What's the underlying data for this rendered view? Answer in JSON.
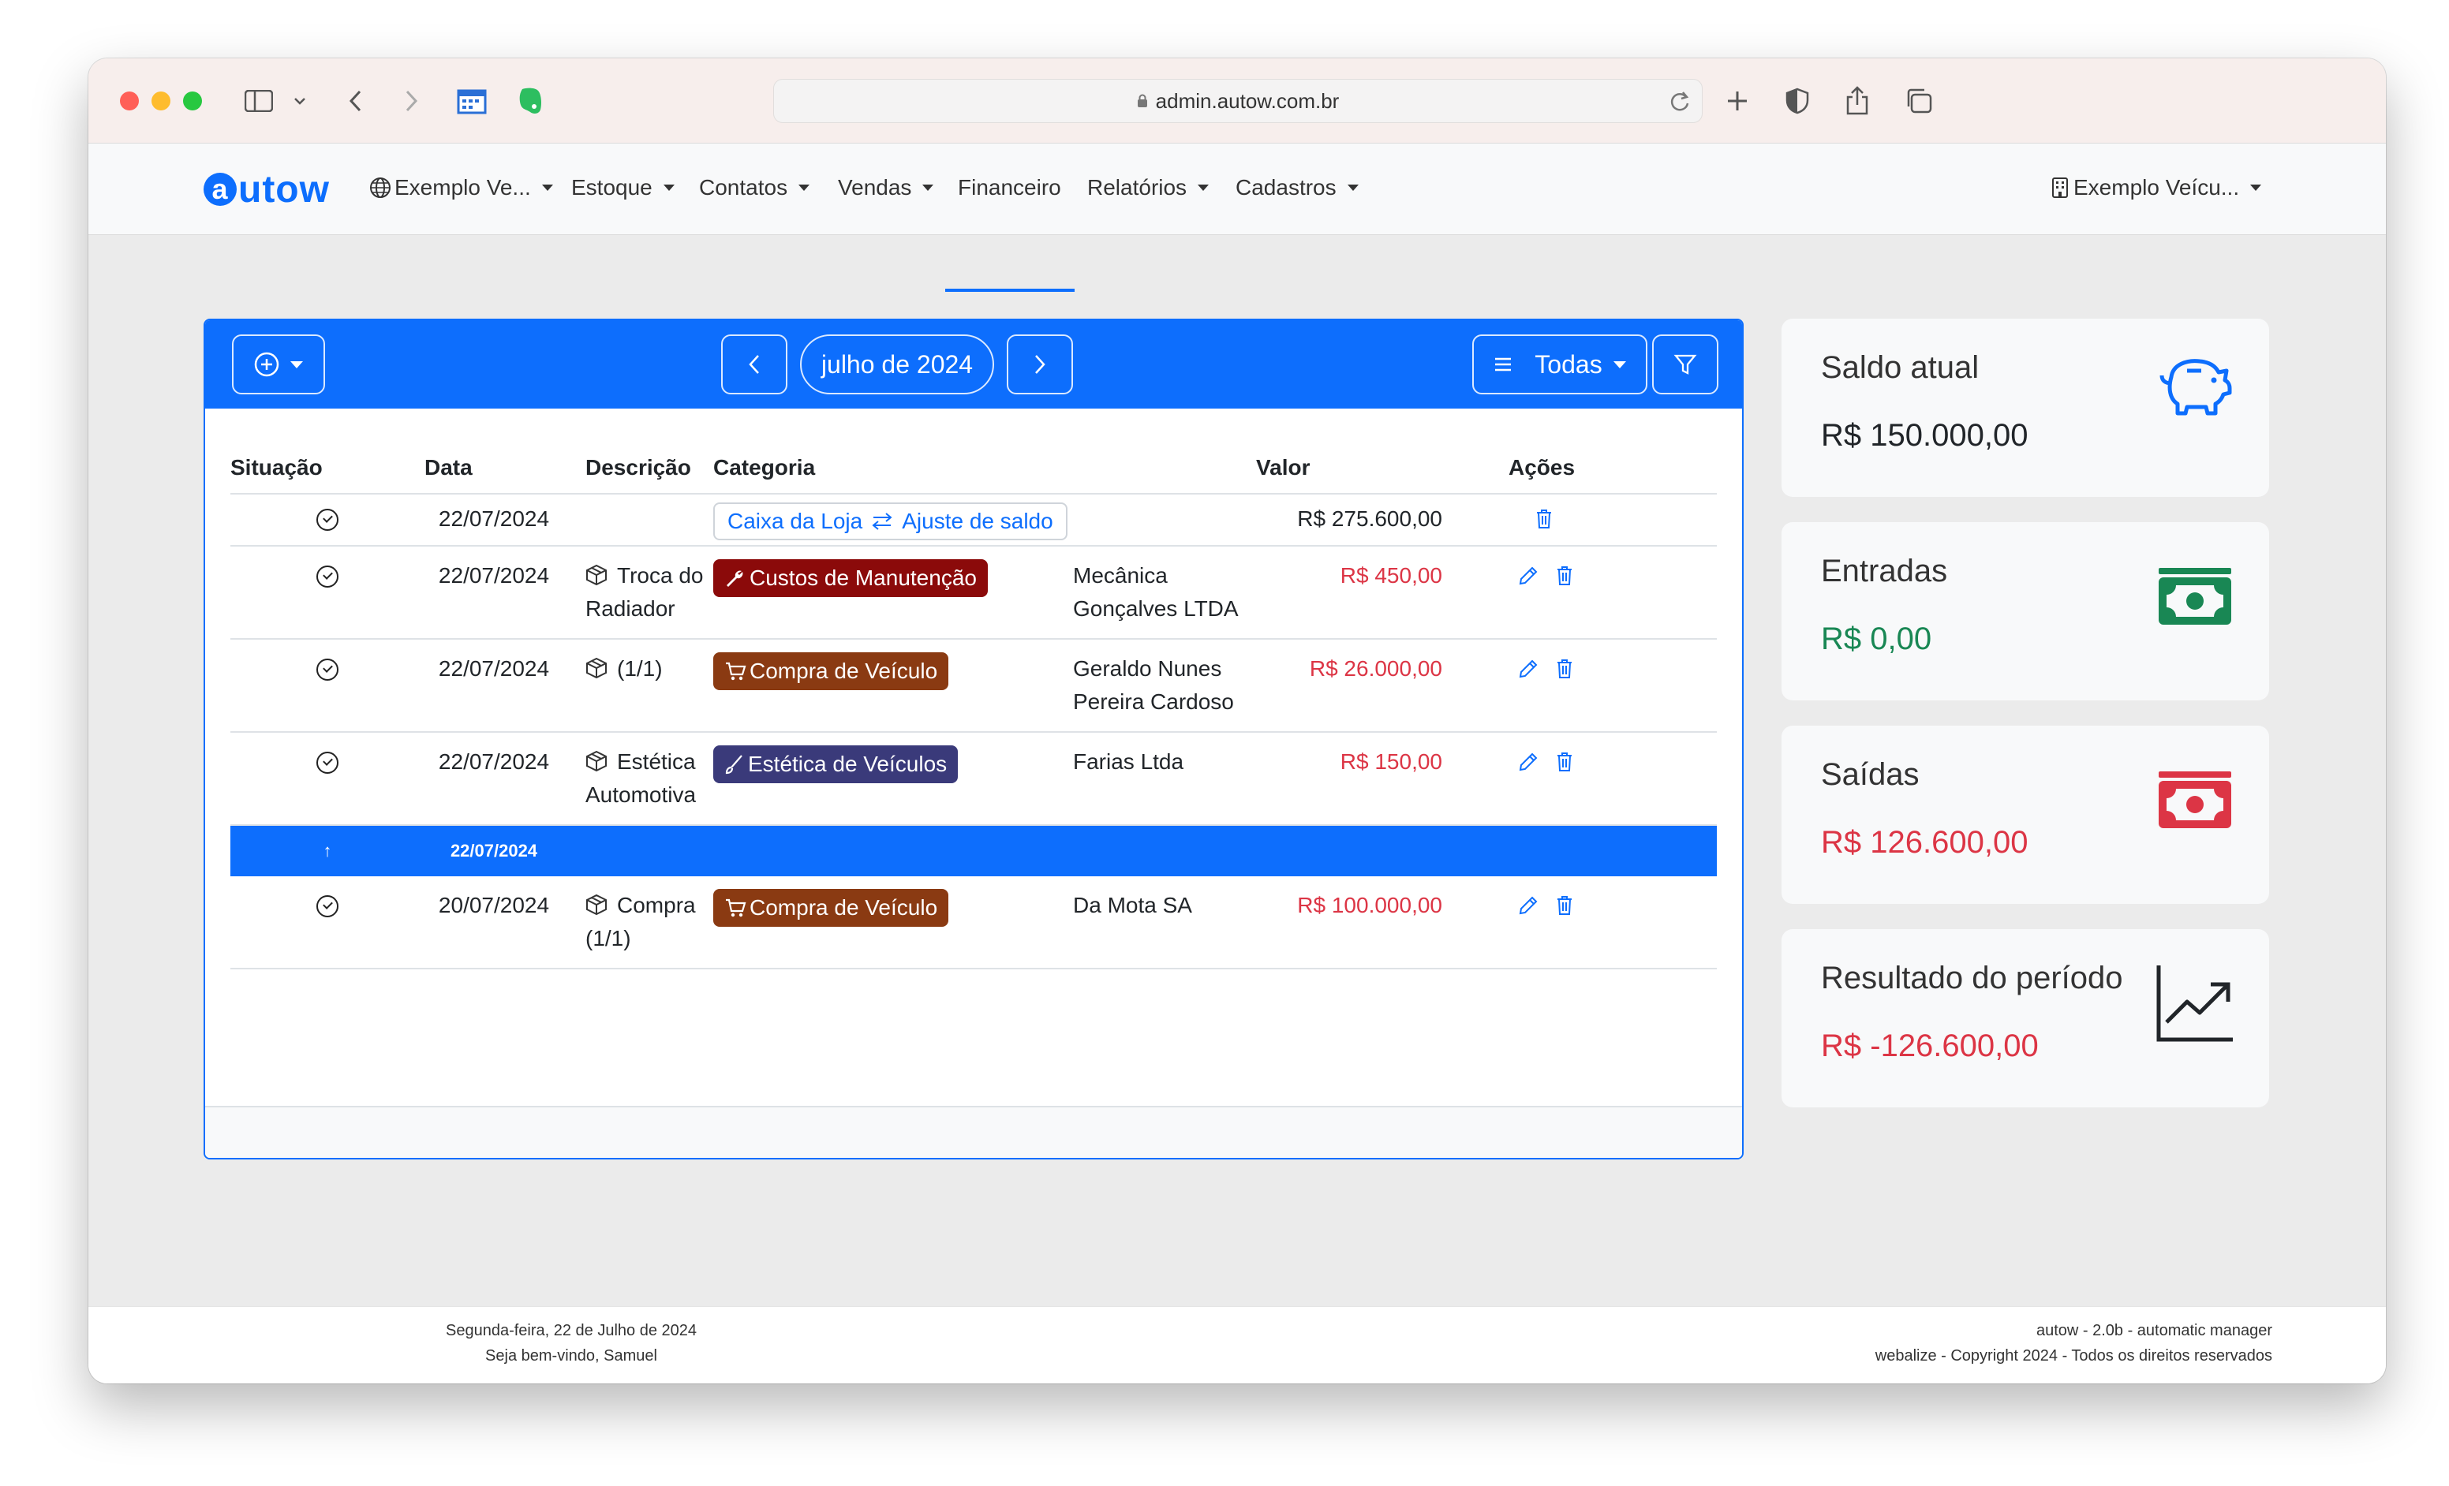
{
  "browser": {
    "url": "admin.autow.com.br",
    "traffic_colors": {
      "close": "#ff5f57",
      "minimize": "#febc2e",
      "maximize": "#28c840"
    }
  },
  "navbar": {
    "logo": "autow",
    "items": [
      {
        "label": "Exemplo Ve...",
        "icon": "globe-icon",
        "dropdown": true
      },
      {
        "label": "Estoque",
        "dropdown": true
      },
      {
        "label": "Contatos",
        "dropdown": true
      },
      {
        "label": "Vendas",
        "dropdown": true
      },
      {
        "label": "Financeiro",
        "dropdown": false,
        "active": true
      },
      {
        "label": "Relatórios",
        "dropdown": true
      },
      {
        "label": "Cadastros",
        "dropdown": true
      }
    ],
    "account": {
      "label": "Exemplo Veícu...",
      "icon": "building-icon"
    }
  },
  "toolbar": {
    "month": "julho de 2024",
    "filter_label": "Todas"
  },
  "table": {
    "headers": {
      "situacao": "Situação",
      "data": "Data",
      "descricao": "Descrição",
      "categoria": "Categoria",
      "valor": "Valor",
      "acoes": "Ações"
    },
    "rows": [
      {
        "date": "22/07/2024",
        "desc": "",
        "category": "Caixa da Loja",
        "category2": "Ajuste de saldo",
        "contact": "",
        "value": "R$ 275.600,00",
        "negative": false
      },
      {
        "date": "22/07/2024",
        "desc": "Troca do Radiador",
        "category": "Custos de Manutenção",
        "contact": "Mecânica Gonçalves LTDA",
        "value": "R$ 450,00",
        "negative": true
      },
      {
        "date": "22/07/2024",
        "desc": "(1/1)",
        "category": "Compra de Veículo",
        "contact": "Geraldo Nunes Pereira Cardoso",
        "value": "R$ 26.000,00",
        "negative": true
      },
      {
        "date": "22/07/2024",
        "desc": "Estética Automotiva",
        "category": "Estética de Veículos",
        "contact": "Farias Ltda",
        "value": "R$ 150,00",
        "negative": true
      },
      {
        "date": "20/07/2024",
        "desc": "Compra (1/1)",
        "category": "Compra de Veículo",
        "contact": "Da Mota SA",
        "value": "R$ 100.000,00",
        "negative": true
      }
    ],
    "separator": {
      "arrow": "↑",
      "date": "22/07/2024"
    },
    "badge_colors": {
      "manutencao": "#8b0a0a",
      "compra": "#8a3a12",
      "estetica": "#3a3a7a"
    }
  },
  "summary": [
    {
      "label": "Saldo atual",
      "value": "R$ 150.000,00",
      "icon": "piggy-bank-icon",
      "color": "#212529"
    },
    {
      "label": "Entradas",
      "value": "R$ 0,00",
      "icon": "cash-icon",
      "color": "#198754"
    },
    {
      "label": "Saídas",
      "value": "R$ 126.600,00",
      "icon": "cash-icon",
      "color": "#dc3545"
    },
    {
      "label": "Resultado do período",
      "value": "R$ -126.600,00",
      "icon": "graph-up-icon",
      "color": "#dc3545"
    }
  ],
  "footer": {
    "date": "Segunda-feira, 22 de Julho de 2024",
    "welcome": "Seja bem-vindo, Samuel",
    "version": "autow - 2.0b - automatic manager",
    "copyright": "webalize - Copyright 2024 - Todos os direitos reservados"
  }
}
